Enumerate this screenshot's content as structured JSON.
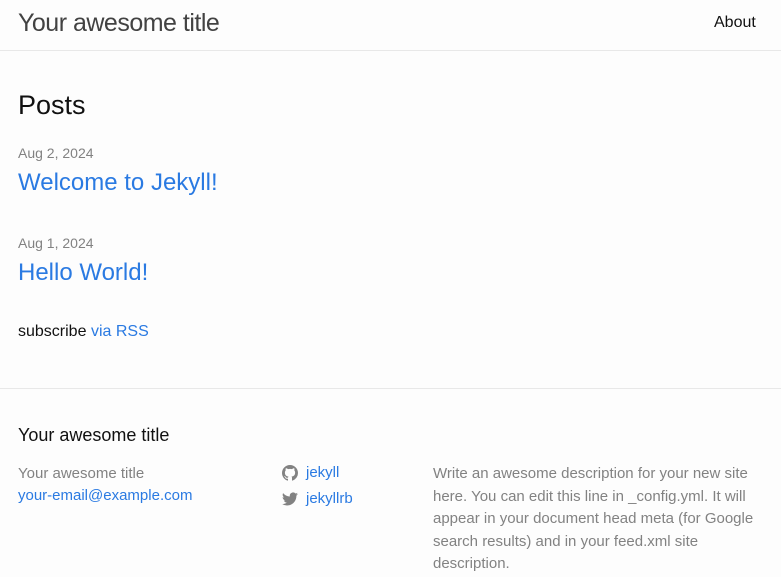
{
  "header": {
    "site_title": "Your awesome title",
    "nav": [
      {
        "label": "About"
      }
    ]
  },
  "main": {
    "heading": "Posts",
    "posts": [
      {
        "date": "Aug 2, 2024",
        "title": "Welcome to Jekyll!"
      },
      {
        "date": "Aug 1, 2024",
        "title": "Hello World!"
      }
    ],
    "subscribe_text": "subscribe",
    "subscribe_link": "via RSS"
  },
  "footer": {
    "heading": "Your awesome title",
    "name": "Your awesome title",
    "email": "your-email@example.com",
    "social": [
      {
        "icon": "github-icon",
        "label": "jekyll"
      },
      {
        "icon": "twitter-icon",
        "label": "jekyllrb"
      }
    ],
    "description": "Write an awesome description for your new site here. You can edit this line in _config.yml. It will appear in your document head meta (for Google search results) and in your feed.xml site description."
  },
  "colors": {
    "link": "#2a7ae2",
    "meta": "#828282",
    "text": "#111111",
    "border": "#e8e8e8",
    "background": "#fdfdfd"
  }
}
